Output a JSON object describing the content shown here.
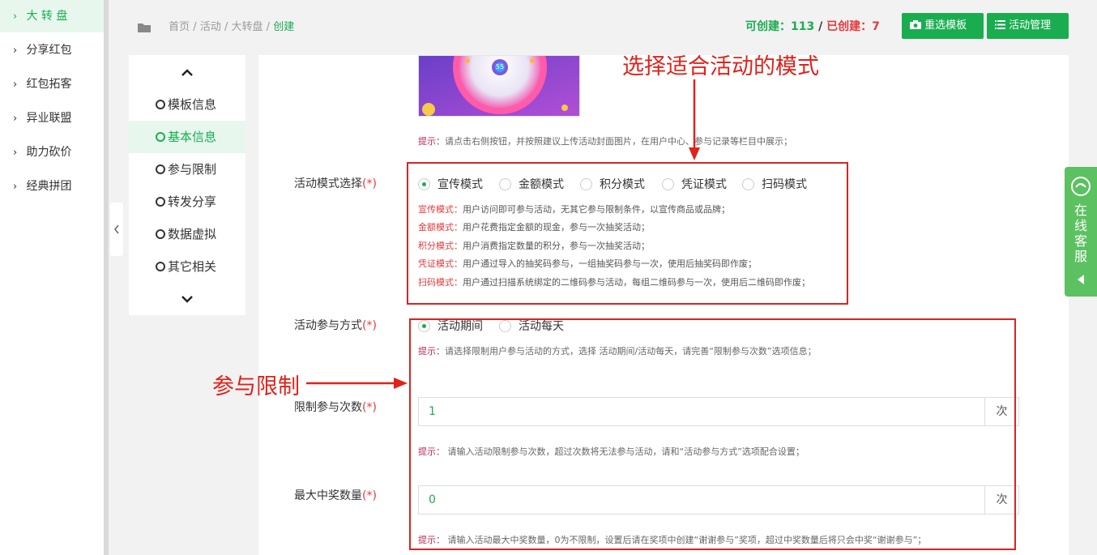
{
  "sidebar": {
    "items": [
      {
        "label": "大 转 盘",
        "active": true
      },
      {
        "label": "分享红包"
      },
      {
        "label": "红包拓客"
      },
      {
        "label": "异业联盟"
      },
      {
        "label": "助力砍价"
      },
      {
        "label": "经典拼团"
      }
    ]
  },
  "breadcrumb": {
    "home": "首页",
    "sep": "/",
    "activity": "活动",
    "wheel": "大转盘",
    "current": "创建"
  },
  "counts": {
    "can_create_label": "可创建：",
    "can_create_value": "113",
    "sep": " / ",
    "created_label": "已创建：",
    "created_value": "7"
  },
  "toolbar": {
    "reselect_label": "重选模板",
    "manage_label": "活动管理"
  },
  "steps": {
    "items": [
      {
        "label": "模板信息"
      },
      {
        "label": "基本信息",
        "active": true
      },
      {
        "label": "参与限制"
      },
      {
        "label": "转发分享"
      },
      {
        "label": "数据虚拟"
      },
      {
        "label": "其它相关"
      }
    ]
  },
  "cover": {
    "badge": "55"
  },
  "cover_tip": {
    "label": "提示：",
    "text": "请点击右侧按钮，并按照建议上传活动封面图片，在用户中心、参与记录等栏目中展示；"
  },
  "mode": {
    "label": "活动模式选择",
    "required": "(*)",
    "options": [
      "宣传模式",
      "金额模式",
      "积分模式",
      "凭证模式",
      "扫码模式"
    ],
    "selected": "宣传模式",
    "descriptions": [
      {
        "name": "宣传模式：",
        "text": "用户访问即可参与活动，无其它参与限制条件，以宣传商品或品牌；"
      },
      {
        "name": "金额模式：",
        "text": "用户花费指定金额的现金，参与一次抽奖活动；"
      },
      {
        "name": "积分模式：",
        "text": "用户消费指定数量的积分，参与一次抽奖活动；"
      },
      {
        "name": "凭证模式：",
        "text": "用户通过导入的抽奖码参与，一组抽奖码参与一次，使用后抽奖码即作废；"
      },
      {
        "name": "扫码模式：",
        "text": "用户通过扫描系统绑定的二维码参与活动，每组二维码参与一次，使用后二维码即作废；"
      }
    ]
  },
  "participation": {
    "label": "活动参与方式",
    "required": "(*)",
    "options": [
      "活动期间",
      "活动每天"
    ],
    "selected": "活动期间",
    "tip_label": "提示：",
    "tip": "请选择限制用户参与活动的方式，选择 活动期间/活动每天，请完善“限制参与次数”选项信息；"
  },
  "limit": {
    "label": "限制参与次数",
    "required": "(*)",
    "value": "1",
    "unit": "次",
    "tip_label": "提示：",
    "tip": " 请输入活动限制参与次数，超过次数将无法参与活动，请和“活动参与方式”选项配合设置；"
  },
  "max_prize": {
    "label": "最大中奖数量",
    "required": "(*)",
    "value": "0",
    "unit": "次",
    "tip_label": "提示：",
    "tip": " 请输入活动最大中奖数量，0为不限制，设置后请在奖项中创建“谢谢参与”奖项，超过中奖数量后将只会中奖“谢谢参与”；"
  },
  "annotations": {
    "mode_note": "选择适合活动的模式",
    "limit_note": "参与限制"
  },
  "service": {
    "label": "在线客服"
  },
  "colors": {
    "green": "#1aad50",
    "red": "#e4393c",
    "annotation_red": "#d62424",
    "service_green": "#5cc160"
  }
}
